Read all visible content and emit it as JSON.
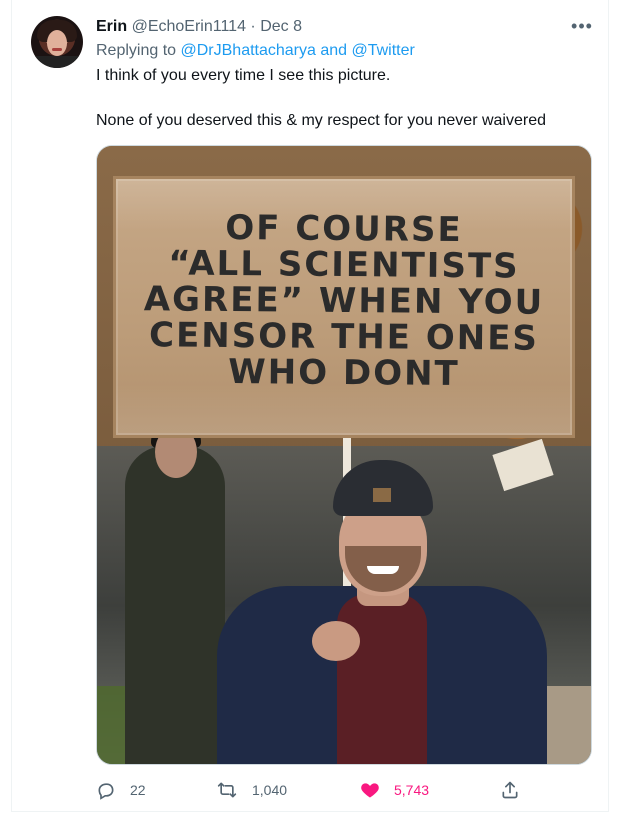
{
  "tweet": {
    "author_name": "Erin",
    "author_handle": "@EchoErin1114",
    "separator": "·",
    "date": "Dec 8",
    "replying_prefix": "Replying to",
    "reply_mentions": "@DrJBhattacharya and @Twitter",
    "text_line1": "I think of you every time I see this picture.",
    "text_line2": "None of you deserved this & my respect for you never waivered",
    "more_label": "•••"
  },
  "photo": {
    "sign_lines": [
      "OF COURSE",
      "“ALL SCIENTISTS",
      "AGREE” WHEN YOU",
      "CENSOR THE ONES",
      "WHO DONT"
    ]
  },
  "actions": {
    "reply_count": "22",
    "retweet_count": "1,040",
    "like_count": "5,743",
    "like_color": "#f91880",
    "icon_names": [
      "reply-icon",
      "retweet-icon",
      "like-icon",
      "share-icon"
    ]
  }
}
